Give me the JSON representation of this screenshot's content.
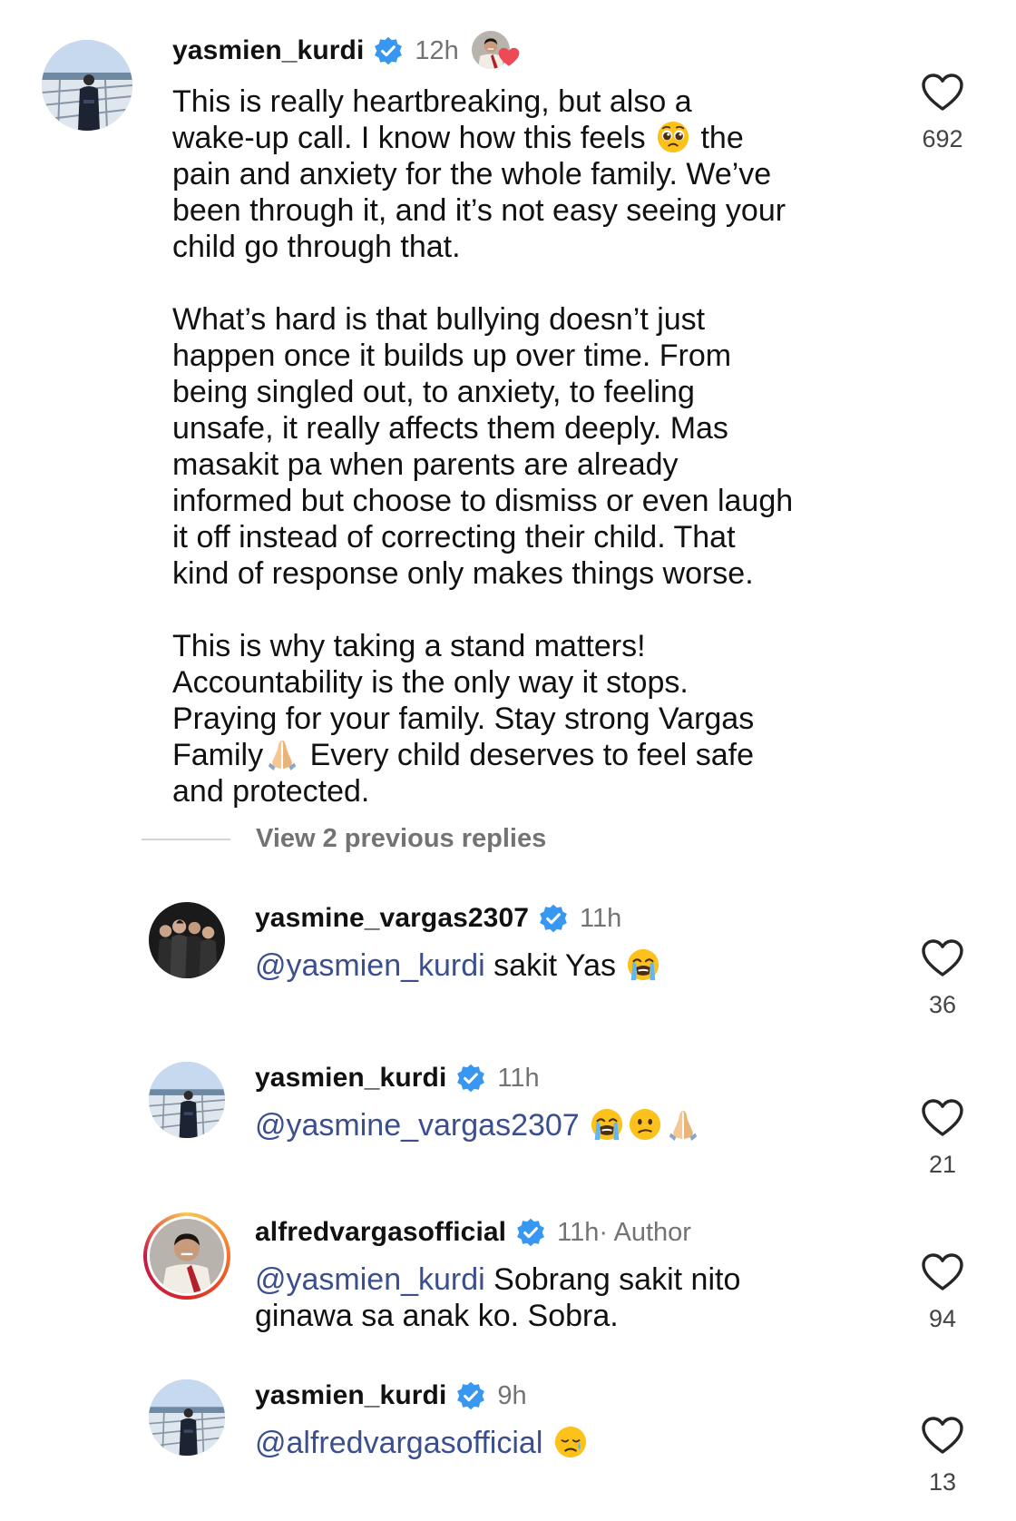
{
  "comments": [
    {
      "username": "yasmien_kurdi",
      "time": "12h",
      "paragraphs": [
        "This is really heartbreaking, but also a\nwake-up call. I know how this feels",
        "the\npain and anxiety for the whole family. We’ve\nbeen through it, and it’s not easy seeing your\nchild go through that.\n\nWhat’s hard is that bullying doesn’t just\nhappen once it builds up over time. From\nbeing singled out, to anxiety, to feeling\nunsafe, it really affects them deeply. Mas\nmasakit pa when parents are already\ninformed but choose to dismiss or even laugh\nit off instead of correcting their child. That\nkind of response only makes things worse.\n\nThis is why taking a stand matters!\nAccountability is the only way it stops.\nPraying for your family. Stay strong Vargas\nFamily",
        "Every child deserves to feel safe\nand protected."
      ],
      "likes": "692"
    },
    {
      "username": "yasmine_vargas2307",
      "time": "11h",
      "mention": "@yasmien_kurdi",
      "text": " sakit Yas ",
      "likes": "36"
    },
    {
      "username": "yasmien_kurdi",
      "time": "11h",
      "mention": "@yasmine_vargas2307",
      "text": " ",
      "likes": "21"
    },
    {
      "username": "alfredvargasofficial",
      "time": "11h",
      "author_label": " · Author",
      "mention": "@yasmien_kurdi",
      "text": " Sobrang sakit nito\nginawa sa anak ko. Sobra.",
      "likes": "94"
    },
    {
      "username": "yasmien_kurdi",
      "time": "9h",
      "mention": "@alfredvargasofficial",
      "text": " ",
      "likes": "13"
    }
  ],
  "view_replies_label": "View 2 previous replies",
  "colors": {
    "verified": "#3897f0",
    "mention": "#3b4f8f",
    "muted": "#737373",
    "heart_outline": "#262626",
    "liked_heart": "#ed4956"
  },
  "icons": {
    "verified": "verified-badge-icon",
    "like": "heart-outline-icon",
    "liked_by_author": "liked-by-author-icon",
    "emojis": [
      "pleading-face-emoji",
      "folded-hands-emoji",
      "loudly-crying-face-emoji",
      "confused-face-emoji",
      "sad-but-relieved-face-emoji"
    ]
  }
}
